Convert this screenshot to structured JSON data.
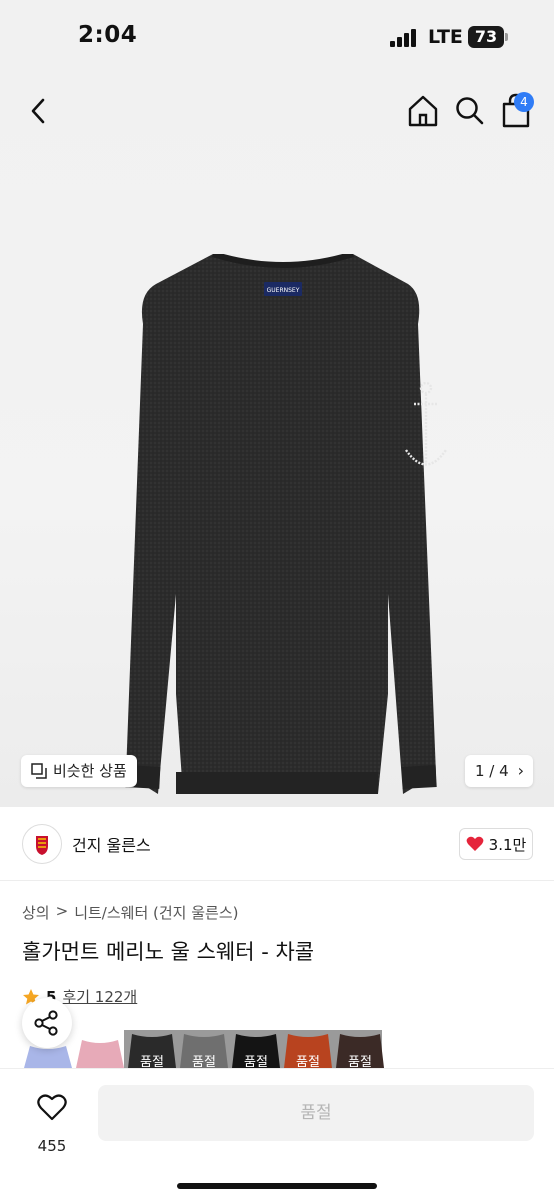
{
  "status_bar": {
    "time": "2:04",
    "network": "LTE",
    "battery": "73"
  },
  "header": {
    "cart_count": "4"
  },
  "gallery": {
    "similar_label": "비슷한 상품",
    "page_indicator": "1 / 4",
    "label_text": "GUERNSEY"
  },
  "brand": {
    "name": "건지 울른스",
    "likes": "3.1만"
  },
  "breadcrumb": {
    "category": "상의",
    "separator": ">",
    "subcategory": "니트/스웨터 (건지 울른스)"
  },
  "product": {
    "title": "홀가먼트 메리노 울 스웨터 - 차콜"
  },
  "rating": {
    "score": "5",
    "reviews": "후기 122개"
  },
  "color_options": [
    {
      "state": "",
      "color": "#a9b6e8"
    },
    {
      "state": "",
      "color": "#e7aab8"
    },
    {
      "state": "품절",
      "color": "#2a2a2a"
    },
    {
      "state": "품절",
      "color": "#6f6f6f"
    },
    {
      "state": "품절",
      "color": "#141414"
    },
    {
      "state": "품절",
      "color": "#b8431f"
    },
    {
      "state": "품절",
      "color": "#3b2a26"
    }
  ],
  "bottom_bar": {
    "wish_count": "455",
    "buy_label": "품절"
  },
  "colors": {
    "accent": "#2f7cf6",
    "heart": "#e5243b",
    "star": "#f5a623"
  }
}
